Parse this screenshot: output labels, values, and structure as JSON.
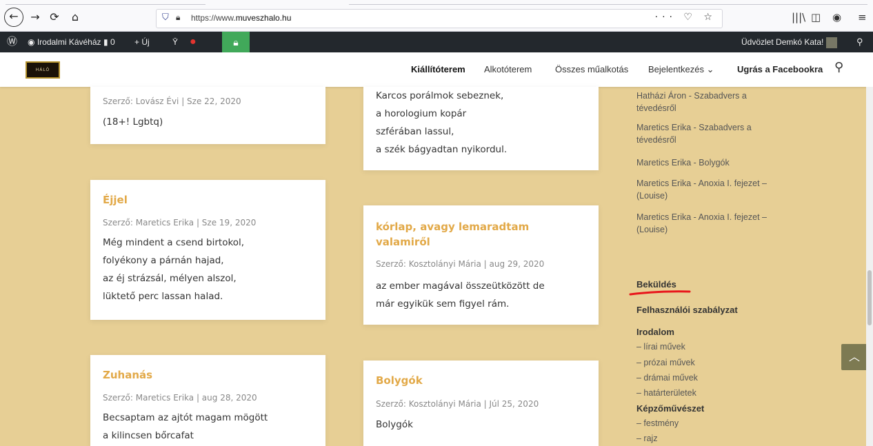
{
  "browser": {
    "url_prefix": "https://www.",
    "url_domain": "muveszhalo.hu",
    "url_dots": "···"
  },
  "wpbar": {
    "site_name": "Irodalmi Kávéház",
    "comments_count": "0",
    "new_label": "Új",
    "greeting": "Üdvözlet Demkó Kata!"
  },
  "header": {
    "logo_text": "HÁLÓ",
    "menu": [
      "Kiállítóterem",
      "Alkotóterem",
      "Összes műalkotás",
      "Bejelentkezés",
      "Ugrás a Facebookra"
    ]
  },
  "posts": [
    {
      "title": "",
      "meta": "Szerző: Lovász Évi | Sze 22, 2020",
      "body": "(18+! Lgbtq)"
    },
    {
      "title": "",
      "meta": "",
      "body": "Karcos porálmok sebeznek,\na horologium kopár\nszférában lassul,\na szék bágyadtan nyikordul."
    },
    {
      "title": "Éjjel",
      "meta": "Szerző: Maretics Erika | Sze 19, 2020",
      "body": "Még mindent a csend birtokol,\nfolyékony a párnán hajad,\naz éj strázsál, mélyen alszol,\nlüktető perc lassan halad."
    },
    {
      "title": "kórlap, avagy lemaradtam\nvalamiről",
      "meta": "Szerző: Kosztolányi Mária | aug 29, 2020",
      "body": "az ember magával összeütközött de\nmár egyikük sem figyel rám."
    },
    {
      "title": "Zuhanás",
      "meta": "Szerző: Maretics Erika | aug 28, 2020",
      "body": "Becsaptam az ajtót magam mögött\na kilincsen bőrcafat"
    },
    {
      "title": "Bolygók",
      "meta": "Szerző: Kosztolányi Mária | Júl 25, 2020",
      "body": "Bolygók"
    }
  ],
  "sidebar": {
    "recent": [
      "Hatházi Áron - Szabadvers a tévedésről",
      "Maretics Erika - Szabadvers a tévedésről",
      "Maretics Erika - Bolygók",
      "Maretics Erika - Anoxia I. fejezet – (Louise)",
      "Maretics Erika - Anoxia I. fejezet – (Louise)"
    ],
    "bekuldes": "Beküldés",
    "szabalyzat": "Felhasználói szabályzat",
    "irodalom": "Irodalom",
    "irodalom_items": [
      "– lírai művek",
      "– prózai művek",
      "– drámai művek",
      "– határterületek"
    ],
    "kepzo": "Képzőművészet",
    "kepzo_items": [
      "– festmény",
      "– rajz"
    ]
  },
  "colors": {
    "accent": "#e2a948",
    "background": "#e7cf95",
    "annotation": "#e8151b"
  }
}
